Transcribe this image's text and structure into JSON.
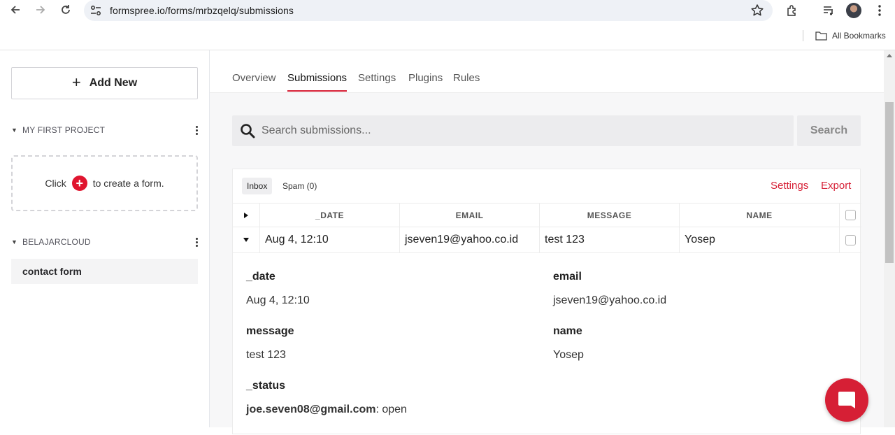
{
  "browser": {
    "url": "formspree.io/forms/mrbzqelq/submissions",
    "bookmarks_label": "All Bookmarks"
  },
  "sidebar": {
    "add_new_label": "Add New",
    "projects": [
      {
        "name": "MY FIRST PROJECT"
      },
      {
        "name": "BELAJARCLOUD"
      }
    ],
    "empty_prefix": "Click",
    "empty_suffix": "to create a form.",
    "forms": [
      {
        "label": "contact form"
      }
    ]
  },
  "tabs": [
    {
      "label": "Overview"
    },
    {
      "label": "Submissions",
      "active": true
    },
    {
      "label": "Settings"
    },
    {
      "label": "Plugins"
    },
    {
      "label": "Rules"
    }
  ],
  "search": {
    "placeholder": "Search submissions...",
    "button_label": "Search"
  },
  "card": {
    "inbox_label": "Inbox",
    "spam_label": "Spam (0)",
    "settings_label": "Settings",
    "export_label": "Export",
    "columns": [
      "_DATE",
      "EMAIL",
      "MESSAGE",
      "NAME"
    ],
    "rows": [
      {
        "date": "Aug 4, 12:10",
        "email": "jseven19@yahoo.co.id",
        "message": "test 123",
        "name": "Yosep"
      }
    ]
  },
  "detail": {
    "date_label": "_date",
    "date_value": "Aug 4, 12:10",
    "email_label": "email",
    "email_value": "jseven19@yahoo.co.id",
    "message_label": "message",
    "message_value": "test 123",
    "name_label": "name",
    "name_value": "Yosep",
    "status_label": "_status",
    "status_user": "joe.seven08@gmail.com",
    "status_value": ": open"
  },
  "colors": {
    "accent": "#d61f35",
    "sidebar_selected_bg": "#f4f4f5",
    "main_bg": "#f7f7f8"
  }
}
